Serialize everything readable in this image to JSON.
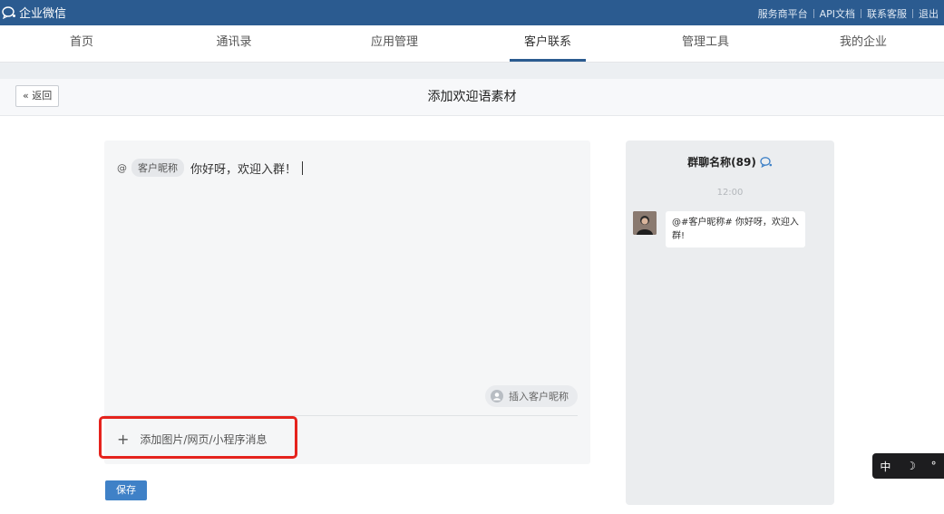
{
  "topbar": {
    "brand": "企业微信",
    "links": [
      "服务商平台",
      "API文档",
      "联系客服",
      "退出"
    ]
  },
  "nav": {
    "items": [
      "首页",
      "通讯录",
      "应用管理",
      "客户联系",
      "管理工具",
      "我的企业"
    ],
    "active": "客户联系"
  },
  "subbar": {
    "back_label": "« 返回",
    "title": "添加欢迎语素材"
  },
  "editor": {
    "at_symbol": "@",
    "nickname_tag": "客户昵称",
    "message": "你好呀，欢迎入群！",
    "insert_nickname_label": "插入客户昵称",
    "insert_icon": "user-icon",
    "add_media_plus": "+",
    "add_media_label": "添加图片/网页/小程序消息",
    "save_label": "保存"
  },
  "preview": {
    "group_name": "群聊名称(89)",
    "time": "12:00",
    "bubble_text": "@#客户昵称# 你好呀，欢迎入群!"
  },
  "ime": {
    "lang": "中",
    "moon": "☽",
    "degree": "°"
  },
  "colors": {
    "topbar": "#2b5b90",
    "primary_button": "#3f81c7",
    "highlight": "#e5231d"
  }
}
